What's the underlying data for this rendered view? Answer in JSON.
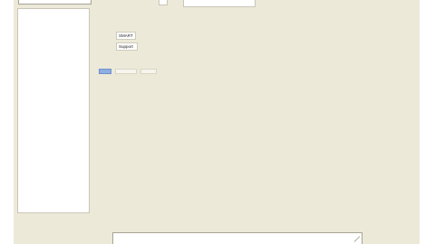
{
  "chips": {
    "smart": "SMART",
    "support": "Support"
  },
  "icons": {
    "resize_grip": "resize-grip-icon"
  },
  "colors": {
    "window_background": "#ece9d8",
    "selected_tab": "#8eaee2",
    "field_background": "#ffffff"
  }
}
